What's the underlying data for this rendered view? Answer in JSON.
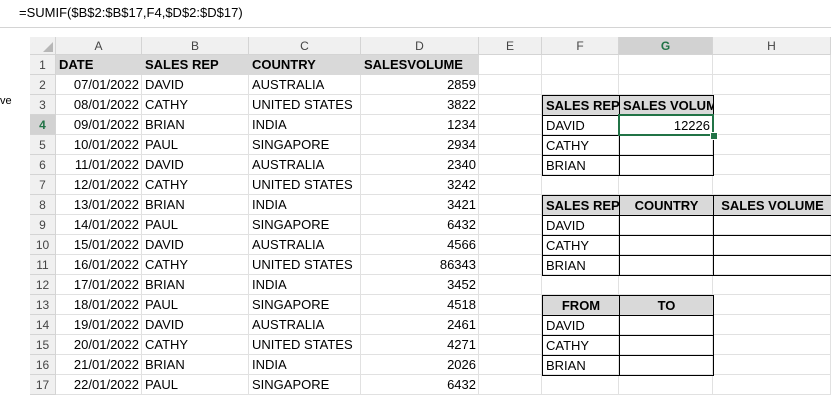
{
  "formula": "=SUMIF($B$2:$B$17,F4,$D$2:$D$17)",
  "side_fragment": "ve",
  "columns": [
    "A",
    "B",
    "C",
    "D",
    "E",
    "F",
    "G",
    "H"
  ],
  "rows": [
    "1",
    "2",
    "3",
    "4",
    "5",
    "6",
    "7",
    "8",
    "9",
    "10",
    "11",
    "12",
    "13",
    "14",
    "15",
    "16",
    "17"
  ],
  "headers": {
    "date": "DATE",
    "rep": "SALES REP",
    "country": "COUNTRY",
    "volume": "SALESVOLUME"
  },
  "data": [
    [
      "07/01/2022",
      "DAVID",
      "AUSTRALIA",
      "2859"
    ],
    [
      "08/01/2022",
      "CATHY",
      "UNITED STATES",
      "3822"
    ],
    [
      "09/01/2022",
      "BRIAN",
      "INDIA",
      "1234"
    ],
    [
      "10/01/2022",
      "PAUL",
      "SINGAPORE",
      "2934"
    ],
    [
      "11/01/2022",
      "DAVID",
      "AUSTRALIA",
      "2340"
    ],
    [
      "12/01/2022",
      "CATHY",
      "UNITED STATES",
      "3242"
    ],
    [
      "13/01/2022",
      "BRIAN",
      "INDIA",
      "3421"
    ],
    [
      "14/01/2022",
      "PAUL",
      "SINGAPORE",
      "6432"
    ],
    [
      "15/01/2022",
      "DAVID",
      "AUSTRALIA",
      "4566"
    ],
    [
      "16/01/2022",
      "CATHY",
      "UNITED STATES",
      "86343"
    ],
    [
      "17/01/2022",
      "BRIAN",
      "INDIA",
      "3452"
    ],
    [
      "18/01/2022",
      "PAUL",
      "SINGAPORE",
      "4518"
    ],
    [
      "19/01/2022",
      "DAVID",
      "AUSTRALIA",
      "2461"
    ],
    [
      "20/01/2022",
      "CATHY",
      "UNITED STATES",
      "4271"
    ],
    [
      "21/01/2022",
      "BRIAN",
      "INDIA",
      "2026"
    ],
    [
      "22/01/2022",
      "PAUL",
      "SINGAPORE",
      "6432"
    ]
  ],
  "table1": {
    "h1": "SALES REP",
    "h2": "SALES VOLUME",
    "rows": [
      [
        "DAVID",
        "12226"
      ],
      [
        "CATHY",
        ""
      ],
      [
        "BRIAN",
        ""
      ]
    ]
  },
  "table2": {
    "h1": "SALES REP",
    "h2": "COUNTRY",
    "h3": "SALES VOLUME",
    "rows": [
      "DAVID",
      "CATHY",
      "BRIAN"
    ]
  },
  "table3": {
    "h1": "FROM",
    "h2": "TO",
    "rows": [
      "DAVID",
      "CATHY",
      "BRIAN"
    ]
  },
  "active_cell": "G4",
  "colors": {
    "header_fill": "#d9d9d9",
    "selection": "#217346",
    "heading_bg": "#f0f0f0"
  }
}
